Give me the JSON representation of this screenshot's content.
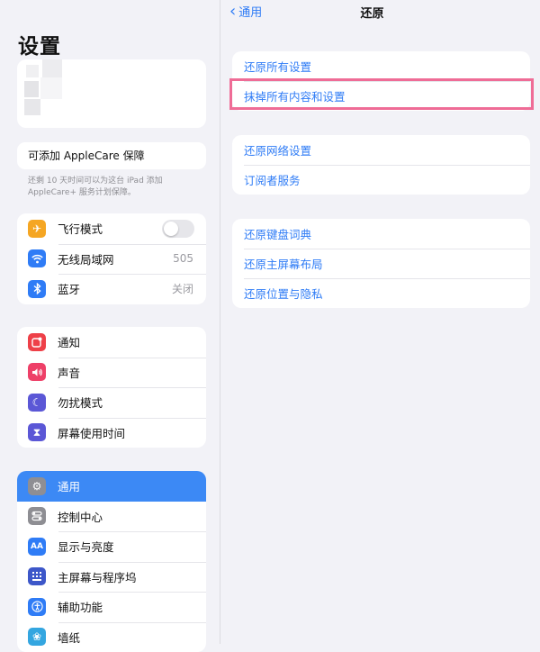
{
  "sidebar": {
    "title": "设置",
    "applecare": {
      "label": "可添加 AppleCare 保障",
      "note": "还剩 10 天时间可以为这台 iPad 添加 AppleCare+ 服务计划保障。"
    },
    "connectivity": [
      {
        "label": "飞行模式",
        "icon": "airplane-icon",
        "color": "#f5a623",
        "toggle": false
      },
      {
        "label": "无线局域网",
        "icon": "wifi-icon",
        "color": "#2f7cf6",
        "value": "505"
      },
      {
        "label": "蓝牙",
        "icon": "bluetooth-icon",
        "color": "#2f7cf6",
        "value": "关闭"
      }
    ],
    "notifications": [
      {
        "label": "通知",
        "icon": "notification-icon",
        "color": "#ee4048"
      },
      {
        "label": "声音",
        "icon": "speaker-icon",
        "color": "#ee4068"
      },
      {
        "label": "勿扰模式",
        "icon": "moon-icon",
        "color": "#5b57d6"
      },
      {
        "label": "屏幕使用时间",
        "icon": "hourglass-icon",
        "color": "#5b57d6"
      }
    ],
    "general": [
      {
        "label": "通用",
        "icon": "gear-icon",
        "color": "#8e8e93",
        "selected": true
      },
      {
        "label": "控制中心",
        "icon": "control-center-icon",
        "color": "#8e8e93"
      },
      {
        "label": "显示与亮度",
        "icon": "aa-icon",
        "glyph": "AA",
        "color": "#2f7cf6"
      },
      {
        "label": "主屏幕与程序坞",
        "icon": "grid-icon",
        "color": "#3d57c9"
      },
      {
        "label": "辅助功能",
        "icon": "accessibility-icon",
        "color": "#2f7cf6"
      },
      {
        "label": "墙纸",
        "icon": "flower-icon",
        "color": "#34a6e0"
      }
    ]
  },
  "main": {
    "back_label": "通用",
    "title": "还原",
    "groups": [
      [
        "还原所有设置",
        "抹掉所有内容和设置"
      ],
      [
        "还原网络设置",
        "订阅者服务"
      ],
      [
        "还原键盘词典",
        "还原主屏幕布局",
        "还原位置与隐私"
      ]
    ]
  },
  "colors": {
    "accent": "#2f7cf6",
    "selected": "#3c89f5",
    "highlight_border": "#ef6c96"
  }
}
